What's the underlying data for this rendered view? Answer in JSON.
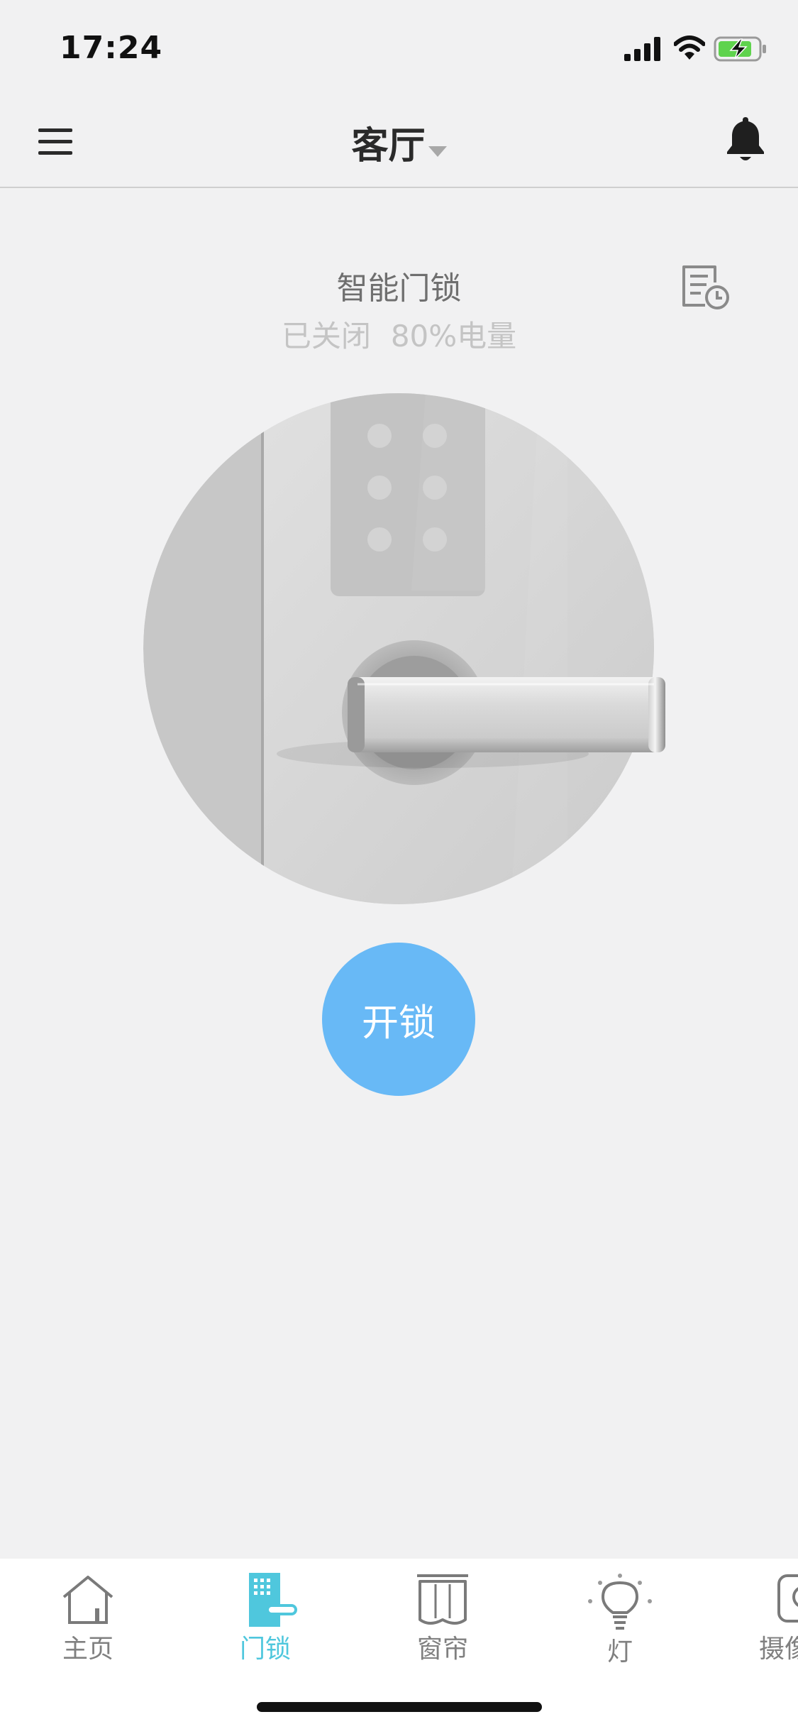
{
  "status_bar": {
    "time": "17:24"
  },
  "header": {
    "room_title": "客厅"
  },
  "device": {
    "name": "智能门锁",
    "lock_state": "已关闭",
    "battery_text": "80%电量",
    "battery_level": 0.8
  },
  "actions": {
    "unlock_label": "开锁"
  },
  "tabs": [
    {
      "label": "主页",
      "icon": "home-icon",
      "active": false
    },
    {
      "label": "门锁",
      "icon": "door-lock-icon",
      "active": true
    },
    {
      "label": "窗帘",
      "icon": "curtain-icon",
      "active": false
    },
    {
      "label": "灯",
      "icon": "bulb-icon",
      "active": false
    },
    {
      "label": "摄像",
      "icon": "camera-icon",
      "active": false
    }
  ],
  "colors": {
    "accent": "#4fc7dd",
    "unlock_button": "#68b9f6",
    "background": "#f1f1f2",
    "tab_inactive": "#808080",
    "battery_fill": "#5fd34d"
  }
}
